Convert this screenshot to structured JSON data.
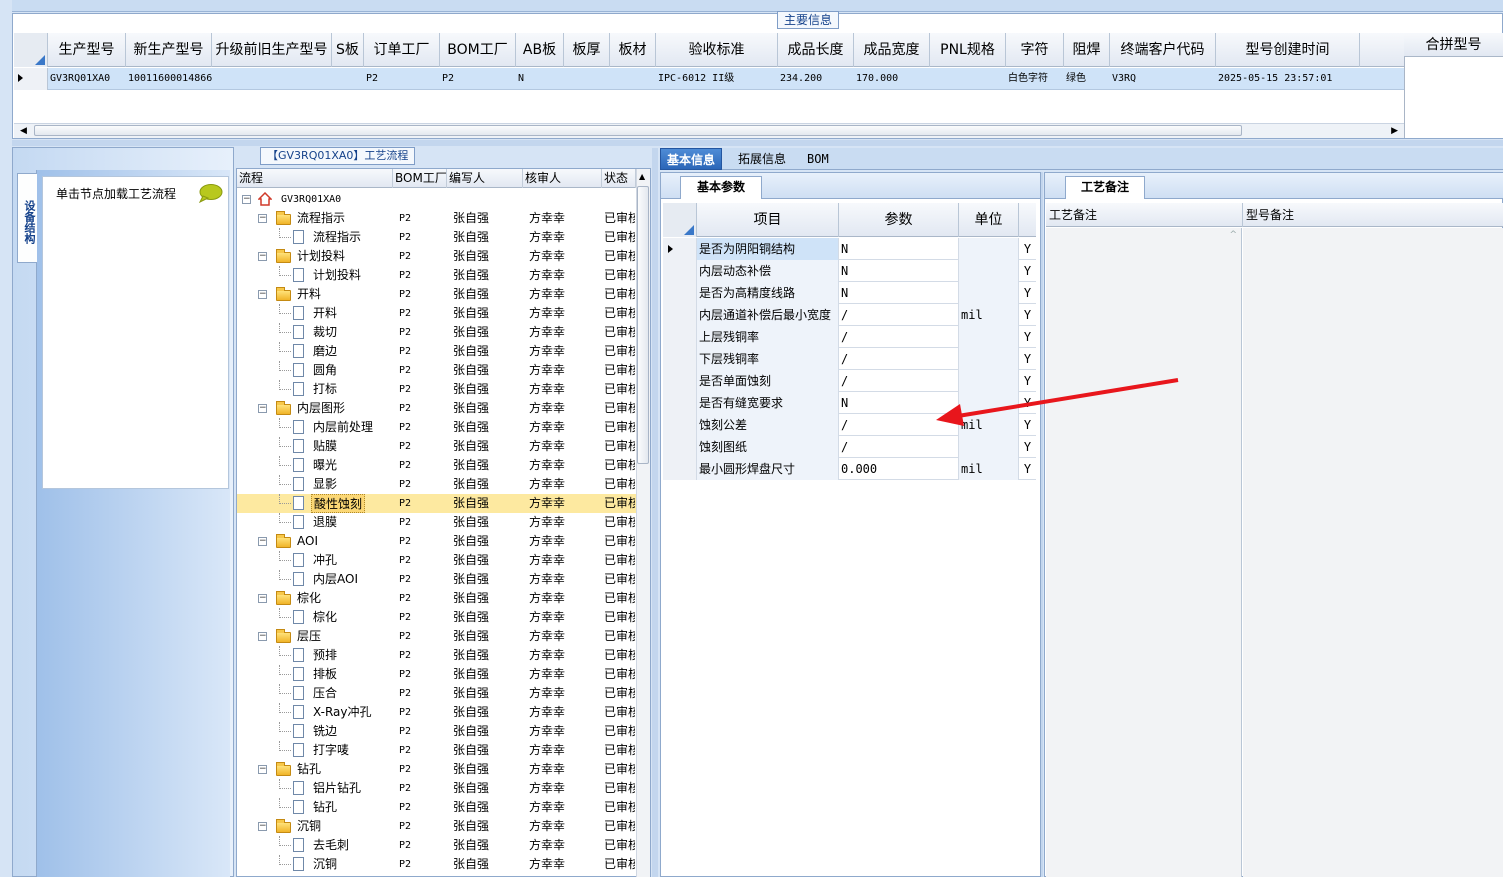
{
  "main_info": {
    "title": "主要信息",
    "columns": [
      "生产型号",
      "新生产型号",
      "升级前旧生产型号",
      "S板",
      "订单工厂",
      "BOM工厂",
      "AB板",
      "板厚",
      "板材",
      "验收标准",
      "成品长度",
      "成品宽度",
      "PNL规格",
      "字符",
      "阻焊",
      "终端客户代码",
      "型号创建时间"
    ],
    "row": [
      "GV3RQ01XA0",
      "10011600014866",
      "",
      "",
      "P2",
      "P2",
      "N",
      "",
      "",
      "IPC-6012 II级",
      "234.200",
      "170.000",
      "",
      "白色字符",
      "绿色",
      "V3RQ",
      "2025-05-15 23:57:01"
    ],
    "merge_title": "合拼型号"
  },
  "left_panel": {
    "vtab_label": "设备结构",
    "hint": "单击节点加载工艺流程"
  },
  "tree": {
    "title": "【GV3RQ01XA0】工艺流程",
    "columns": [
      "流程",
      "BOM工厂",
      "编写人",
      "核审人",
      "状态"
    ],
    "root": "GV3RQ01XA0",
    "rows": [
      {
        "label": "流程指示",
        "level": 1,
        "folder": true,
        "bom": "P2",
        "writer": "张自强",
        "reviewer": "方幸幸",
        "status": "已审核"
      },
      {
        "label": "流程指示",
        "level": 2,
        "folder": false,
        "bom": "P2",
        "writer": "张自强",
        "reviewer": "方幸幸",
        "status": "已审核"
      },
      {
        "label": "计划投料",
        "level": 1,
        "folder": true,
        "bom": "P2",
        "writer": "张自强",
        "reviewer": "方幸幸",
        "status": "已审核"
      },
      {
        "label": "计划投料",
        "level": 2,
        "folder": false,
        "bom": "P2",
        "writer": "张自强",
        "reviewer": "方幸幸",
        "status": "已审核"
      },
      {
        "label": "开料",
        "level": 1,
        "folder": true,
        "bom": "P2",
        "writer": "张自强",
        "reviewer": "方幸幸",
        "status": "已审核"
      },
      {
        "label": "开料",
        "level": 2,
        "folder": false,
        "bom": "P2",
        "writer": "张自强",
        "reviewer": "方幸幸",
        "status": "已审核"
      },
      {
        "label": "裁切",
        "level": 2,
        "folder": false,
        "bom": "P2",
        "writer": "张自强",
        "reviewer": "方幸幸",
        "status": "已审核"
      },
      {
        "label": "磨边",
        "level": 2,
        "folder": false,
        "bom": "P2",
        "writer": "张自强",
        "reviewer": "方幸幸",
        "status": "已审核"
      },
      {
        "label": "圆角",
        "level": 2,
        "folder": false,
        "bom": "P2",
        "writer": "张自强",
        "reviewer": "方幸幸",
        "status": "已审核"
      },
      {
        "label": "打标",
        "level": 2,
        "folder": false,
        "bom": "P2",
        "writer": "张自强",
        "reviewer": "方幸幸",
        "status": "已审核"
      },
      {
        "label": "内层图形",
        "level": 1,
        "folder": true,
        "bom": "P2",
        "writer": "张自强",
        "reviewer": "方幸幸",
        "status": "已审核"
      },
      {
        "label": "内层前处理",
        "level": 2,
        "folder": false,
        "bom": "P2",
        "writer": "张自强",
        "reviewer": "方幸幸",
        "status": "已审核"
      },
      {
        "label": "贴膜",
        "level": 2,
        "folder": false,
        "bom": "P2",
        "writer": "张自强",
        "reviewer": "方幸幸",
        "status": "已审核"
      },
      {
        "label": "曝光",
        "level": 2,
        "folder": false,
        "bom": "P2",
        "writer": "张自强",
        "reviewer": "方幸幸",
        "status": "已审核"
      },
      {
        "label": "显影",
        "level": 2,
        "folder": false,
        "bom": "P2",
        "writer": "张自强",
        "reviewer": "方幸幸",
        "status": "已审核"
      },
      {
        "label": "酸性蚀刻",
        "level": 2,
        "folder": false,
        "bom": "P2",
        "writer": "张自强",
        "reviewer": "方幸幸",
        "status": "已审核",
        "selected": true
      },
      {
        "label": "退膜",
        "level": 2,
        "folder": false,
        "bom": "P2",
        "writer": "张自强",
        "reviewer": "方幸幸",
        "status": "已审核"
      },
      {
        "label": "AOI",
        "level": 1,
        "folder": true,
        "bom": "P2",
        "writer": "张自强",
        "reviewer": "方幸幸",
        "status": "已审核"
      },
      {
        "label": "冲孔",
        "level": 2,
        "folder": false,
        "bom": "P2",
        "writer": "张自强",
        "reviewer": "方幸幸",
        "status": "已审核"
      },
      {
        "label": "内层AOI",
        "level": 2,
        "folder": false,
        "bom": "P2",
        "writer": "张自强",
        "reviewer": "方幸幸",
        "status": "已审核"
      },
      {
        "label": "棕化",
        "level": 1,
        "folder": true,
        "bom": "P2",
        "writer": "张自强",
        "reviewer": "方幸幸",
        "status": "已审核"
      },
      {
        "label": "棕化",
        "level": 2,
        "folder": false,
        "bom": "P2",
        "writer": "张自强",
        "reviewer": "方幸幸",
        "status": "已审核"
      },
      {
        "label": "层压",
        "level": 1,
        "folder": true,
        "bom": "P2",
        "writer": "张自强",
        "reviewer": "方幸幸",
        "status": "已审核"
      },
      {
        "label": "预排",
        "level": 2,
        "folder": false,
        "bom": "P2",
        "writer": "张自强",
        "reviewer": "方幸幸",
        "status": "已审核"
      },
      {
        "label": "排板",
        "level": 2,
        "folder": false,
        "bom": "P2",
        "writer": "张自强",
        "reviewer": "方幸幸",
        "status": "已审核"
      },
      {
        "label": "压合",
        "level": 2,
        "folder": false,
        "bom": "P2",
        "writer": "张自强",
        "reviewer": "方幸幸",
        "status": "已审核"
      },
      {
        "label": "X-Ray冲孔",
        "level": 2,
        "folder": false,
        "bom": "P2",
        "writer": "张自强",
        "reviewer": "方幸幸",
        "status": "已审核"
      },
      {
        "label": "铣边",
        "level": 2,
        "folder": false,
        "bom": "P2",
        "writer": "张自强",
        "reviewer": "方幸幸",
        "status": "已审核"
      },
      {
        "label": "打字唛",
        "level": 2,
        "folder": false,
        "bom": "P2",
        "writer": "张自强",
        "reviewer": "方幸幸",
        "status": "已审核"
      },
      {
        "label": "钻孔",
        "level": 1,
        "folder": true,
        "bom": "P2",
        "writer": "张自强",
        "reviewer": "方幸幸",
        "status": "已审核"
      },
      {
        "label": "铝片钻孔",
        "level": 2,
        "folder": false,
        "bom": "P2",
        "writer": "张自强",
        "reviewer": "方幸幸",
        "status": "已审核"
      },
      {
        "label": "钻孔",
        "level": 2,
        "folder": false,
        "bom": "P2",
        "writer": "张自强",
        "reviewer": "方幸幸",
        "status": "已审核"
      },
      {
        "label": "沉铜",
        "level": 1,
        "folder": true,
        "bom": "P2",
        "writer": "张自强",
        "reviewer": "方幸幸",
        "status": "已审核"
      },
      {
        "label": "去毛刺",
        "level": 2,
        "folder": false,
        "bom": "P2",
        "writer": "张自强",
        "reviewer": "方幸幸",
        "status": "已审核"
      },
      {
        "label": "沉铜",
        "level": 2,
        "folder": false,
        "bom": "P2",
        "writer": "张自强",
        "reviewer": "方幸幸",
        "status": "已审核"
      }
    ]
  },
  "tabs": [
    "基本信息",
    "拓展信息",
    "BOM"
  ],
  "params": {
    "section": "基本参数",
    "columns": [
      "项目",
      "参数",
      "单位"
    ],
    "rows": [
      {
        "item": "是否为阴阳铜结构",
        "value": "N",
        "unit": "",
        "flag": "Y"
      },
      {
        "item": "内层动态补偿",
        "value": "N",
        "unit": "",
        "flag": "Y"
      },
      {
        "item": "是否为高精度线路",
        "value": "N",
        "unit": "",
        "flag": "Y"
      },
      {
        "item": "内层通道补偿后最小宽度",
        "value": "/",
        "unit": "mil",
        "flag": "Y"
      },
      {
        "item": "上层残铜率",
        "value": "/",
        "unit": "",
        "flag": "Y"
      },
      {
        "item": "下层残铜率",
        "value": "/",
        "unit": "",
        "flag": "Y"
      },
      {
        "item": "是否单面蚀刻",
        "value": "/",
        "unit": "",
        "flag": "Y"
      },
      {
        "item": "是否有缝宽要求",
        "value": "N",
        "unit": "",
        "flag": "Y"
      },
      {
        "item": "蚀刻公差",
        "value": "/",
        "unit": "mil",
        "flag": "Y"
      },
      {
        "item": "蚀刻图纸",
        "value": "/",
        "unit": "",
        "flag": "Y"
      },
      {
        "item": "最小圆形焊盘尺寸",
        "value": "0.000",
        "unit": "mil",
        "flag": "Y"
      }
    ]
  },
  "notes": {
    "section": "工艺备注",
    "columns": [
      "工艺备注",
      "型号备注"
    ]
  },
  "colors": {
    "selected_row": "#fde9a0",
    "accent": "#2b66b8",
    "arrow": "#e8161c"
  }
}
